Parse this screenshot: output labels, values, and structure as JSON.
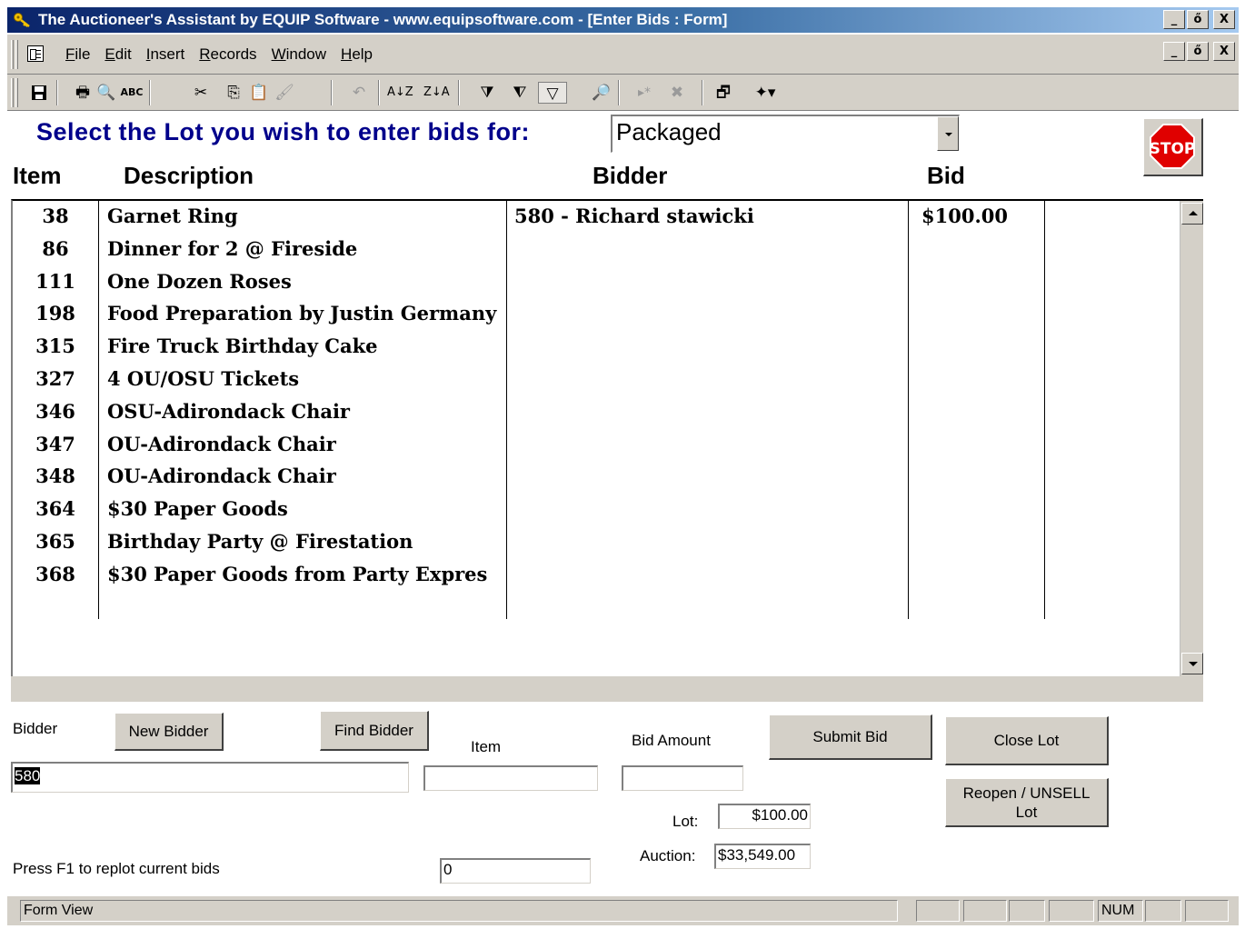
{
  "window": {
    "title": "The Auctioneer's Assistant by EQUIP Software - www.equipsoftware.com - [Enter Bids : Form]",
    "buttons": {
      "minimize": "_",
      "restore": "ő",
      "close": "X"
    }
  },
  "menu": {
    "items": [
      {
        "label": "File",
        "accel": "F"
      },
      {
        "label": "Edit",
        "accel": "E"
      },
      {
        "label": "Insert",
        "accel": "I"
      },
      {
        "label": "Records",
        "accel": "R"
      },
      {
        "label": "Window",
        "accel": "W"
      },
      {
        "label": "Help",
        "accel": "H"
      }
    ]
  },
  "toolbar": {
    "icons": [
      "save-icon",
      "print-icon",
      "print-preview-icon",
      "spelling-icon",
      "cut-icon",
      "copy-icon",
      "paste-icon",
      "format-painter-icon",
      "undo-icon",
      "sort-ascending-icon",
      "sort-descending-icon",
      "filter-by-selection-icon",
      "filter-by-form-icon",
      "apply-filter-icon",
      "find-icon",
      "new-record-icon",
      "delete-record-icon",
      "database-window-icon",
      "new-object-icon"
    ]
  },
  "form": {
    "prompt": "Select the Lot you wish to enter bids for:",
    "lot_value": "Packaged",
    "stop_label": "STOP",
    "columns": {
      "item": "Item",
      "description": "Description",
      "bidder": "Bidder",
      "bid": "Bid"
    },
    "rows": [
      {
        "item": "38",
        "description": "Garnet Ring",
        "bidder": "580 - Richard stawicki",
        "bid": "$100.00"
      },
      {
        "item": "86",
        "description": "Dinner for 2 @ Fireside",
        "bidder": "",
        "bid": ""
      },
      {
        "item": "111",
        "description": "One Dozen Roses",
        "bidder": "",
        "bid": ""
      },
      {
        "item": "198",
        "description": "Food Preparation by Justin Germany",
        "bidder": "",
        "bid": ""
      },
      {
        "item": "315",
        "description": "Fire Truck Birthday Cake",
        "bidder": "",
        "bid": ""
      },
      {
        "item": "327",
        "description": "4 OU/OSU Tickets",
        "bidder": "",
        "bid": ""
      },
      {
        "item": "346",
        "description": "OSU-Adirondack Chair",
        "bidder": "",
        "bid": ""
      },
      {
        "item": "347",
        "description": "OU-Adirondack Chair",
        "bidder": "",
        "bid": ""
      },
      {
        "item": "348",
        "description": "OU-Adirondack Chair",
        "bidder": "",
        "bid": ""
      },
      {
        "item": "364",
        "description": "$30 Paper Goods",
        "bidder": "",
        "bid": ""
      },
      {
        "item": "365",
        "description": "Birthday Party @ Firestation",
        "bidder": "",
        "bid": ""
      },
      {
        "item": "368",
        "description": "$30 Paper Goods from Party Expres",
        "bidder": "",
        "bid": ""
      }
    ],
    "bidder_label": "Bidder",
    "new_bidder": "New Bidder",
    "find_bidder": "Find Bidder",
    "item_label": "Item",
    "bid_amount_label": "Bid Amount",
    "submit_bid": "Submit Bid",
    "close_lot": "Close Lot",
    "reopen_line1": "Reopen / UNSELL",
    "reopen_line2": "Lot",
    "bidder_value": "580",
    "item_value": "",
    "bid_amount_value": "",
    "lot_label": "Lot:",
    "lot_total": "$100.00",
    "auction_label": "Auction:",
    "auction_total": "$33,549.00",
    "hint": "Press F1 to replot current bids",
    "counter_value": "0"
  },
  "status": {
    "mode": "Form View",
    "num": "NUM"
  }
}
